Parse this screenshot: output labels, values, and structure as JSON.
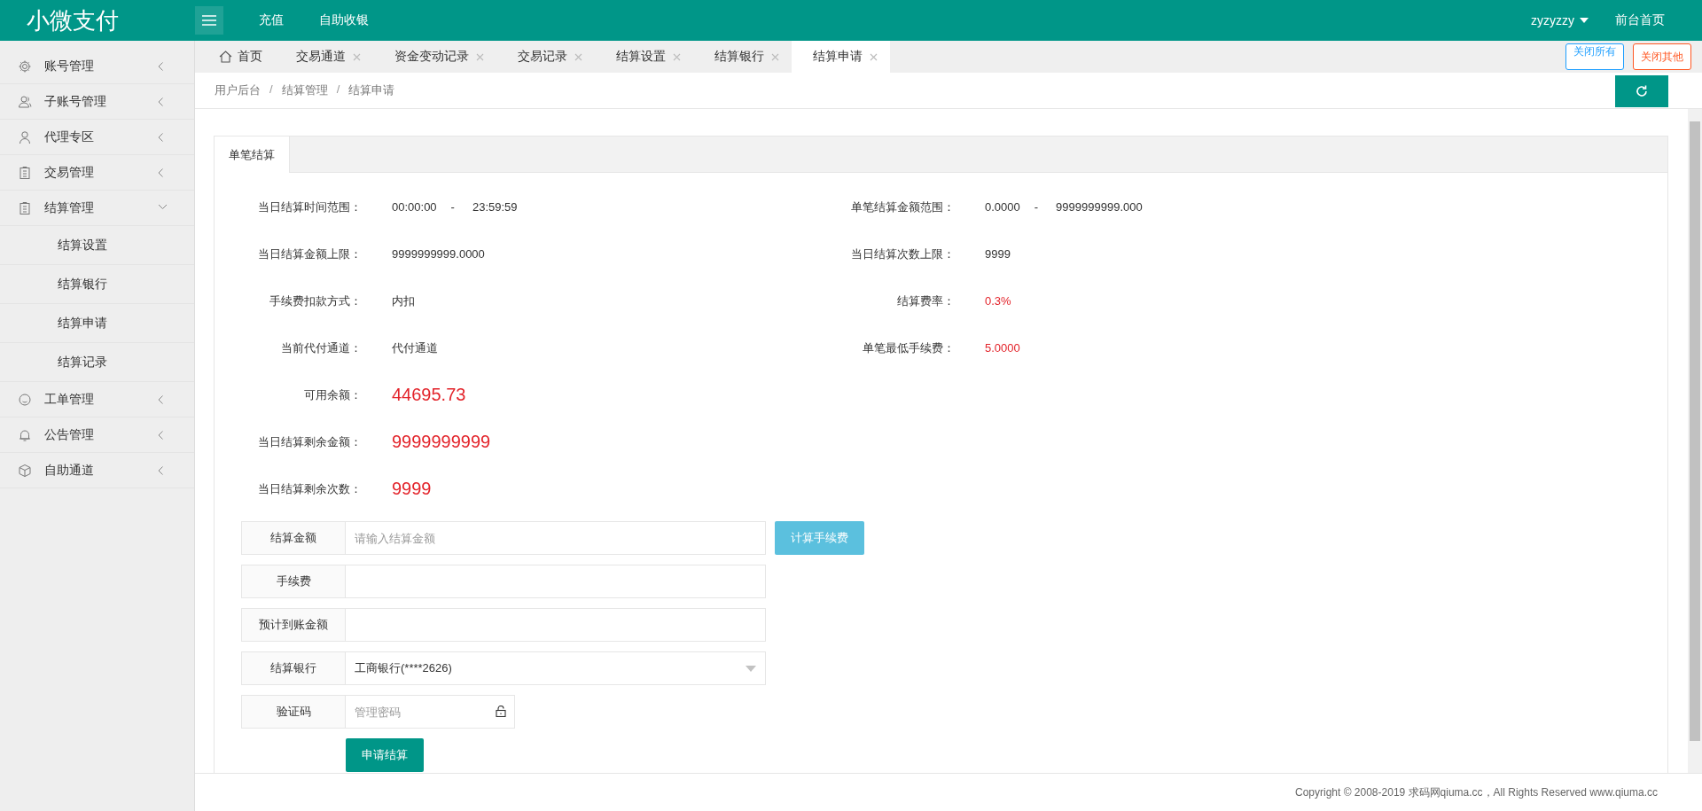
{
  "brand": "小微支付",
  "top_nav": [
    {
      "label": "充值"
    },
    {
      "label": "自助收银"
    }
  ],
  "user": {
    "name": "zyzyzzy"
  },
  "front_link": "前台首页",
  "sidebar": {
    "items": [
      {
        "label": "账号管理",
        "expanded": false
      },
      {
        "label": "子账号管理",
        "expanded": false
      },
      {
        "label": "代理专区",
        "expanded": false
      },
      {
        "label": "交易管理",
        "expanded": false
      },
      {
        "label": "结算管理",
        "expanded": true,
        "children": [
          {
            "label": "结算设置"
          },
          {
            "label": "结算银行"
          },
          {
            "label": "结算申请"
          },
          {
            "label": "结算记录"
          }
        ]
      },
      {
        "label": "工单管理",
        "expanded": false
      },
      {
        "label": "公告管理",
        "expanded": false
      },
      {
        "label": "自助通道",
        "expanded": false
      }
    ]
  },
  "tabs": [
    {
      "label": "首页",
      "kind": "home",
      "selected": false
    },
    {
      "label": "交易通道",
      "kind": "page",
      "selected": false
    },
    {
      "label": "资金变动记录",
      "kind": "page",
      "selected": false
    },
    {
      "label": "交易记录",
      "kind": "page",
      "selected": false
    },
    {
      "label": "结算设置",
      "kind": "page",
      "selected": false
    },
    {
      "label": "结算银行",
      "kind": "page",
      "selected": false
    },
    {
      "label": "结算申请",
      "kind": "page",
      "selected": true
    }
  ],
  "tab_actions": [
    {
      "label": "关闭所有",
      "kind": "info"
    },
    {
      "label": "关闭其他",
      "kind": "danger"
    }
  ],
  "breadcrumb": {
    "separator": "/",
    "items": [
      "用户后台",
      "结算管理",
      "结算申请"
    ]
  },
  "card": {
    "tabs": [
      {
        "label": "单笔结算",
        "selected": true
      }
    ],
    "info_left": [
      {
        "label": "当日结算时间范围：",
        "kind": "range",
        "value": "00:00:00",
        "separator": "-",
        "value2": "23:59:59"
      },
      {
        "label": "当日结算金额上限：",
        "kind": "plain",
        "value": "9999999999.0000"
      },
      {
        "label": "手续费扣款方式：",
        "kind": "plain",
        "value": "内扣"
      },
      {
        "label": "当前代付通道：",
        "kind": "plain",
        "value": "代付通道"
      },
      {
        "label": "可用余额：",
        "kind": "amount",
        "value": "44695.73"
      },
      {
        "label": "当日结算剩余金额：",
        "kind": "amount",
        "value": "9999999999"
      },
      {
        "label": "当日结算剩余次数：",
        "kind": "amount",
        "value": "9999"
      }
    ],
    "info_right": [
      {
        "label": "单笔结算金额范围：",
        "kind": "range",
        "value": "0.0000",
        "separator": "-",
        "value2": "9999999999.000"
      },
      {
        "label": "当日结算次数上限：",
        "kind": "plain",
        "value": "9999"
      },
      {
        "label": "结算费率：",
        "kind": "rate",
        "value": "0.3%"
      },
      {
        "label": "单笔最低手续费：",
        "kind": "rate",
        "value": "5.0000"
      }
    ],
    "form": [
      {
        "label": "结算金额",
        "kind": "input",
        "placeholder": "请输入结算金额",
        "button": "计算手续费"
      },
      {
        "label": "手续费",
        "kind": "input"
      },
      {
        "label": "预计到账金额",
        "kind": "input"
      },
      {
        "label": "结算银行",
        "kind": "select",
        "value": "工商银行(****2626)"
      },
      {
        "label": "验证码",
        "kind": "password",
        "placeholder": "管理密码"
      }
    ],
    "submit": "申请结算"
  },
  "footer": "Copyright © 2008-2019 求码网qiuma.cc，All Rights Reserved www.qiuma.cc"
}
